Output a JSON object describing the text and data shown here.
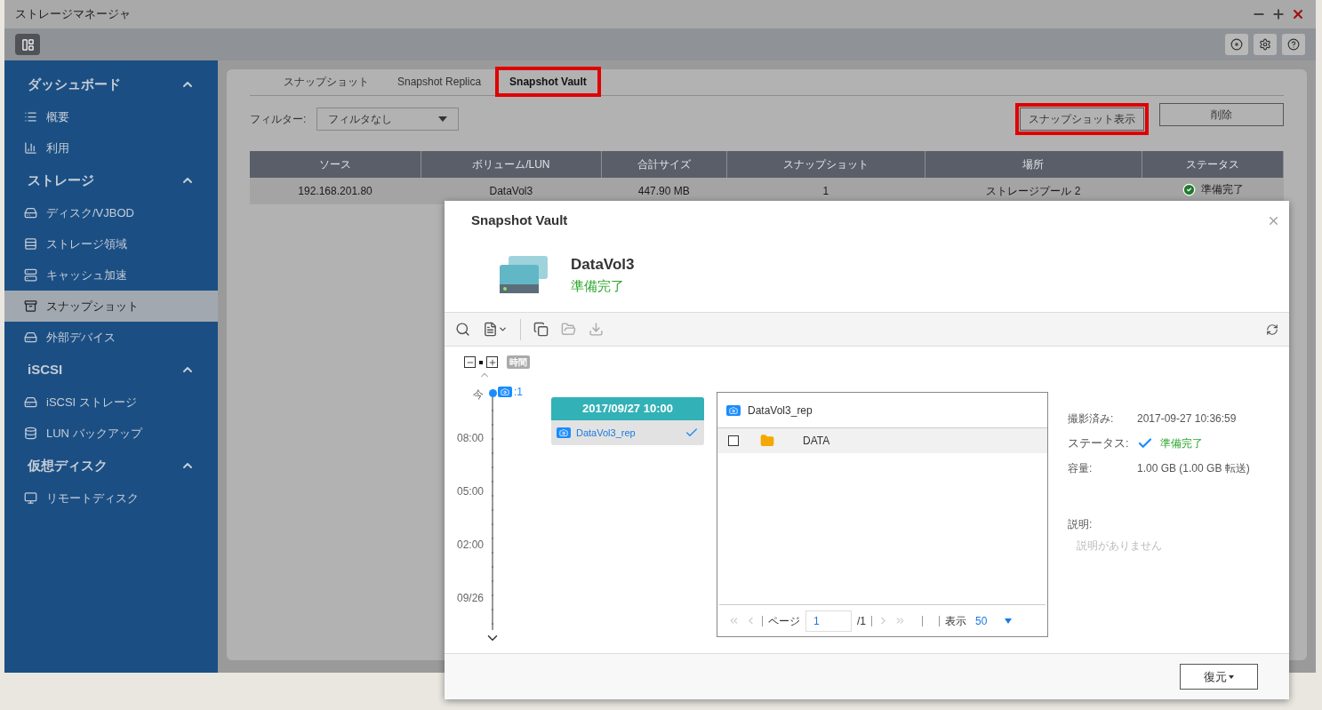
{
  "window": {
    "title": "ストレージマネージャ"
  },
  "sidebar": {
    "sections": [
      {
        "title": "ダッシュボード",
        "expanded": true,
        "items": [
          {
            "label": "概要",
            "selected": false
          },
          {
            "label": "利用",
            "selected": false
          }
        ]
      },
      {
        "title": "ストレージ",
        "expanded": true,
        "items": [
          {
            "label": "ディスク/VJBOD",
            "selected": false
          },
          {
            "label": "ストレージ領域",
            "selected": false
          },
          {
            "label": "キャッシュ加速",
            "selected": false
          },
          {
            "label": "スナップショット",
            "selected": true
          },
          {
            "label": "外部デバイス",
            "selected": false
          }
        ]
      },
      {
        "title": "iSCSI",
        "expanded": true,
        "items": [
          {
            "label": "iSCSI ストレージ",
            "selected": false
          },
          {
            "label": "LUN バックアップ",
            "selected": false
          }
        ]
      },
      {
        "title": "仮想ディスク",
        "expanded": true,
        "items": [
          {
            "label": "リモートディスク",
            "selected": false
          }
        ]
      }
    ]
  },
  "tabs": [
    {
      "label": "スナップショット",
      "selected": false,
      "highlighted": false
    },
    {
      "label": "Snapshot Replica",
      "selected": false,
      "highlighted": false
    },
    {
      "label": "Snapshot Vault",
      "selected": true,
      "highlighted": true
    }
  ],
  "filter": {
    "label": "フィルター:",
    "value": "フィルタなし"
  },
  "buttons": [
    {
      "label": "スナップショット表示",
      "highlighted": true
    },
    {
      "label": "削除",
      "highlighted": false
    }
  ],
  "table": {
    "columns": [
      "ソース",
      "ボリューム/LUN",
      "合計サイズ",
      "スナップショット",
      "場所",
      "ステータス"
    ],
    "rows": [
      {
        "cells": [
          "192.168.201.80",
          "DataVol3",
          "447.90 MB",
          "1",
          "ストレージプール 2",
          "準備完了"
        ],
        "status_ok": true
      }
    ]
  },
  "dialog": {
    "title": "Snapshot Vault",
    "volume": "DataVol3",
    "volume_status": "準備完了",
    "timeline": {
      "zoom_label": "時間",
      "now_label": "今",
      "count": ":1",
      "ticks": [
        "08:00",
        "05:00",
        "02:00",
        "09/26"
      ]
    },
    "snapshot": {
      "date": "2017/09/27 10:00",
      "name": "DataVol3_rep",
      "selected": true
    },
    "files": {
      "header": "DataVol3_rep",
      "rows": [
        {
          "name": "DATA",
          "checked": false
        }
      ],
      "pager": {
        "page_label": "ページ",
        "page": "1",
        "total": "/1",
        "show_label": "表示",
        "per_page": "50"
      }
    },
    "details": [
      {
        "label": "撮影済み:",
        "value": "2017-09-27 10:36:59",
        "kind": "text"
      },
      {
        "label": "ステータス:",
        "value": "準備完了",
        "kind": "status"
      },
      {
        "label": "容量:",
        "value": "1.00 GB (1.00 GB 転送)",
        "kind": "text"
      }
    ],
    "description_label": "説明:",
    "description_empty": "説明がありません",
    "restore_button": "復元"
  }
}
